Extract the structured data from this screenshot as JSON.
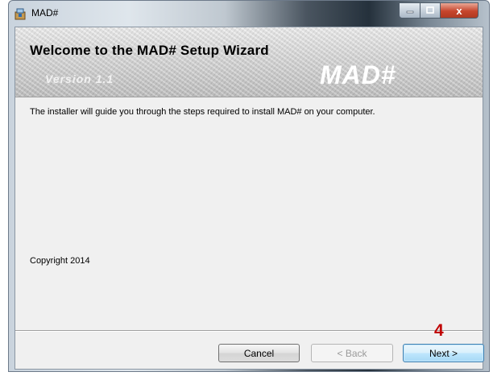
{
  "window": {
    "title": "MAD#"
  },
  "title_buttons": {
    "minimize": "",
    "maximize": "",
    "close": "x"
  },
  "banner": {
    "title": "Welcome to the MAD# Setup Wizard",
    "version": "Version 1.1",
    "logo": "MAD#"
  },
  "body": {
    "intro": "The installer will guide you through the steps required to install MAD# on your computer.",
    "copyright": "Copyright 2014"
  },
  "buttons": {
    "cancel": "Cancel",
    "back": "< Back",
    "next": "Next >"
  },
  "annotation": {
    "step": "4",
    "color": "#c00000"
  },
  "icons": {
    "app": "installer-box-icon",
    "minimize": "minimize-icon",
    "maximize": "maximize-icon",
    "close": "close-icon"
  },
  "colors": {
    "next_button_border": "#3c7fb1",
    "close_button": "#c6452c"
  }
}
